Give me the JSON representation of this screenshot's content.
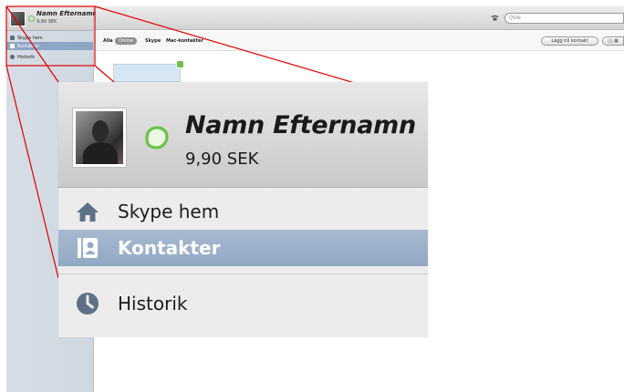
{
  "profile": {
    "name": "Namn Efternamn",
    "credit": "9,90 SEK",
    "small_credit": "9,90 SEK"
  },
  "sidebar": {
    "items": [
      {
        "label": "Skype hem",
        "icon": "home-icon",
        "active": false
      },
      {
        "label": "Kontakter",
        "icon": "contacts-icon",
        "active": true
      },
      {
        "label": "Historik",
        "icon": "clock-icon",
        "active": false
      }
    ]
  },
  "toolbar": {
    "search_placeholder": "Sök"
  },
  "filters": {
    "all": "Alla",
    "online": "Online",
    "skype": "Skype",
    "mac": "Mac-kontakter",
    "add_contact": "Lägg till kontakt",
    "view_toggle": "▯▯ ▦"
  },
  "colors": {
    "accent_selected": "#92a8c4",
    "status_online": "#6cc24a",
    "callout": "#e00000"
  }
}
